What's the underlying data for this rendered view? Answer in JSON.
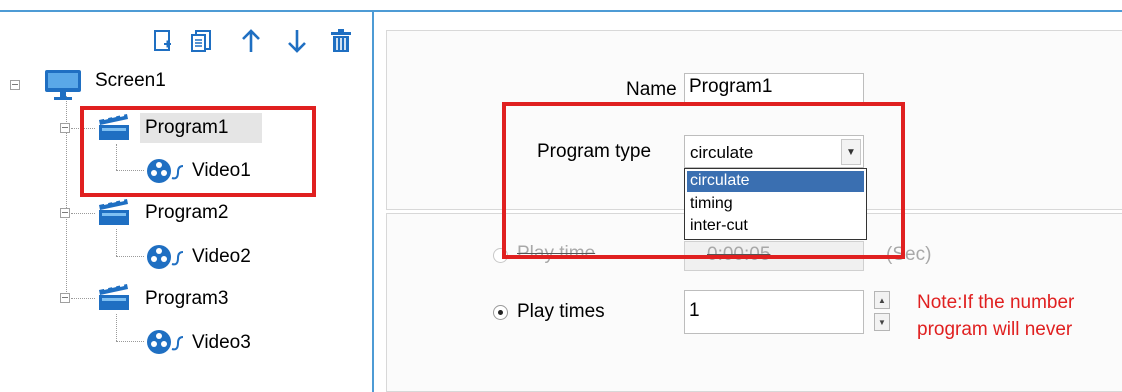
{
  "toolbar": {
    "icons": [
      "new-item-icon",
      "copy-icon",
      "move-up-icon",
      "move-down-icon",
      "delete-icon"
    ],
    "icon_color": "#1f6fc2"
  },
  "tree": {
    "screen": {
      "label": "Screen1"
    },
    "programs": [
      {
        "label": "Program1",
        "selected": true,
        "video": "Video1"
      },
      {
        "label": "Program2",
        "selected": false,
        "video": "Video2"
      },
      {
        "label": "Program3",
        "selected": false,
        "video": "Video3"
      }
    ]
  },
  "form": {
    "name_label": "Name",
    "name_value": "Program1",
    "program_type_label": "Program type",
    "program_type_value": "circulate",
    "program_type_options": [
      "circulate",
      "timing",
      "inter-cut"
    ],
    "play_time_label": "Play time",
    "play_time_value": "0:00:05",
    "play_time_unit": "(Sec)",
    "play_time_selected": false,
    "play_times_label": "Play times",
    "play_times_value": "1",
    "play_times_selected": true,
    "note_line1": "Note:If the number",
    "note_line2": "program will never"
  },
  "colors": {
    "highlight_box": "#e02020",
    "accent_rule": "#4d9bd5",
    "dropdown_selected": "#3a6fb1"
  }
}
